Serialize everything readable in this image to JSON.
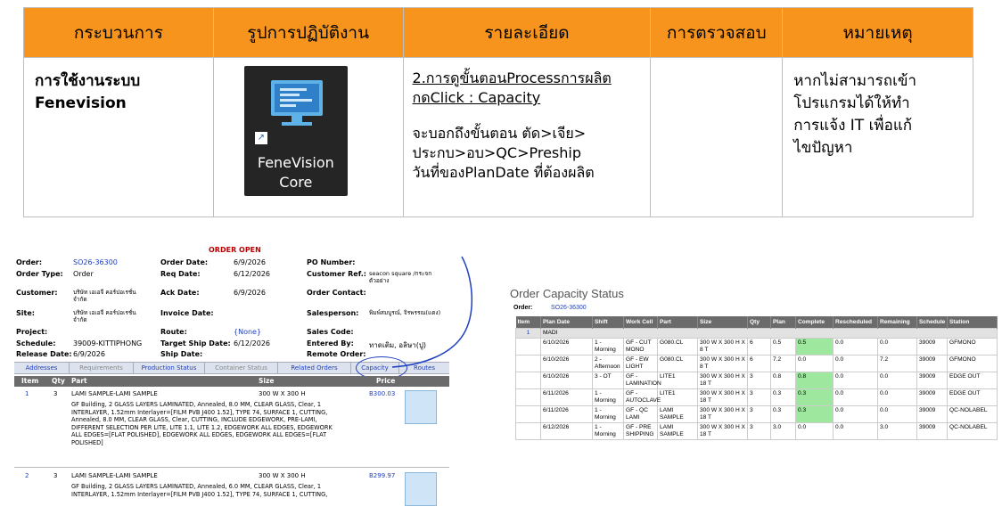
{
  "top_table": {
    "headers": [
      "กระบวนการ",
      "รูปการปฏิบัติงาน",
      "รายละเอียด",
      "การตรวจสอบ",
      "หมายเหตุ"
    ],
    "process_line1": "การใช้งานระบบ",
    "process_line2": "Fenevision",
    "icon": {
      "name": "fenevision-core-icon",
      "label_line1": "FeneVision",
      "label_line2": "Core"
    },
    "detail_line1": "2.การดูขั้นตอนProcessการผลิต",
    "detail_line2": "กดClick : Capacity",
    "detail_line3": "จะบอกถึงขั้นตอน ตัด>เจีย>",
    "detail_line4": "ประกบ>อบ>QC>Preship",
    "detail_line5": "วันที่ของPlanDate ที่ต้องผลิต",
    "check": "",
    "note_line1": "หากไม่สามารถเข้า",
    "note_line2": "โปรแกรมได้ให้ทำ",
    "note_line3": "การแจ้ง IT  เพื่อแก้",
    "note_line4": "ไขปัญหา"
  },
  "order_detail": {
    "title": "ORDER OPEN",
    "order_label": "Order:",
    "order_value": "SO26-36300",
    "order_date_label": "Order Date:",
    "order_date_value": "6/9/2026",
    "po_label": "PO Number:",
    "po_value": "",
    "order_type_label": "Order Type:",
    "order_type_value": "Order",
    "req_date_label": "Req Date:",
    "req_date_value": "6/12/2026",
    "cust_ref_label": "Customer Ref.:",
    "cust_ref_value": "seacon square /กระจกตัวอย่าง",
    "customer_label": "Customer:",
    "customer_value": "บริษัท เอเอจี คอร์ปอเรชั่นจำกัด",
    "ack_date_label": "Ack Date:",
    "ack_date_value": "6/9/2026",
    "order_contact_label": "Order Contact:",
    "order_contact_value": "",
    "site_label": "Site:",
    "site_value": "บริษัท เอเอจี คอร์ปอเรชั่นจำกัด",
    "invoice_date_label": "Invoice Date:",
    "invoice_date_value": "",
    "salesperson_label": "Salesperson:",
    "salesperson_value": "พิมพ์สมบูรณ์, จิรพรรณ(แดง)",
    "project_label": "Project:",
    "project_value": "",
    "route_label": "Route:",
    "route_value": "{None}",
    "sales_code_label": "Sales Code:",
    "sales_code_value": "",
    "schedule_label": "Schedule:",
    "schedule_value": "39009-KITTIPHONG",
    "target_ship_label": "Target Ship Date:",
    "target_ship_value": "6/12/2026",
    "entered_by_label": "Entered By:",
    "entered_by_value": "ทาดเติม, อลิษา(ปู)",
    "release_date_label": "Release Date:",
    "release_date_value": "6/9/2026",
    "ship_date_label": "Ship Date:",
    "ship_date_value": "",
    "remote_order_label": "Remote Order:",
    "remote_order_value": "",
    "tabs": [
      "Addresses",
      "Requirements",
      "Production Status",
      "Container Status",
      "Related Orders",
      "Capacity",
      "Routes"
    ],
    "item_headers": {
      "item": "Item",
      "qty": "Qty",
      "part": "Part",
      "size": "Size",
      "price": "Price"
    },
    "items": [
      {
        "item": "1",
        "qty": "3",
        "part": "LAMI SAMPLE-LAMI SAMPLE",
        "size": "300 W X 300 H",
        "price": "B300.03",
        "desc": "GF Building, 2 GLASS LAYERS LAMINATED, Annealed, 8.0 MM, CLEAR GLASS, Clear, 1 INTERLAYER, 1.52mm Interlayer=[FILM PVB J400 1.52], TYPE 74, SURFACE 1, CUTTING, Annealed, 8.0 MM, CLEAR GLASS, Clear, CUTTING, INCLUDE EDGEWORK, PRE-LAMI, DIFFERENT SELECTION PER LITE, LITE 1.1, LITE 1.2, EDGEWORK ALL EDGES, EDGEWORK ALL EDGES=[FLAT POLISHED], EDGEWORK ALL EDGES, EDGEWORK ALL EDGES=[FLAT POLISHED]"
      },
      {
        "item": "2",
        "qty": "3",
        "part": "LAMI SAMPLE-LAMI SAMPLE",
        "size": "300 W X 300 H",
        "price": "B299.97",
        "desc": "GF Building, 2 GLASS LAYERS LAMINATED, Annealed, 6.0 MM, CLEAR GLASS, Clear, 1 INTERLAYER, 1.52mm Interlayer=[FILM PVB J400 1.52], TYPE 74, SURFACE 1, CUTTING,"
      }
    ]
  },
  "capacity": {
    "title": "Order Capacity Status",
    "order_label": "Order:",
    "order_value": "SO26-36300",
    "headers": [
      "Item",
      "Plan Date",
      "Shift",
      "Work Cell",
      "Part",
      "Size",
      "Qty",
      "Plan",
      "Complete",
      "Rescheduled",
      "Remaining",
      "Schedule",
      "Station"
    ],
    "group_row": {
      "item": "1",
      "label": "MADI"
    },
    "rows": [
      [
        "",
        "6/10/2026",
        "1 - Morning",
        "GF - CUT MONO",
        "G080.CL",
        "300 W X 300 H X 8 T",
        "6",
        "0.5",
        "0.5",
        "0.0",
        "0.0",
        "39009",
        "GFMONO"
      ],
      [
        "",
        "6/10/2026",
        "2 - Afternoon",
        "GF - EW LIGHT",
        "G080.CL",
        "300 W X 300 H X 8 T",
        "6",
        "7.2",
        "0.0",
        "0.0",
        "7.2",
        "39009",
        "GFMONO"
      ],
      [
        "",
        "6/10/2026",
        "3 - OT",
        "GF - LAMINATION",
        "LITE1",
        "300 W X 300 H X 18 T",
        "3",
        "0.8",
        "0.8",
        "0.0",
        "0.0",
        "39009",
        "EDGE OUT"
      ],
      [
        "",
        "6/11/2026",
        "1 - Morning",
        "GF - AUTOCLAVE",
        "LITE1",
        "300 W X 300 H X 18 T",
        "3",
        "0.3",
        "0.3",
        "0.0",
        "0.0",
        "39009",
        "EDGE OUT"
      ],
      [
        "",
        "6/11/2026",
        "1 - Morning",
        "GF - QC LAMI",
        "LAMI SAMPLE",
        "300 W X 300 H X 18 T",
        "3",
        "0.3",
        "0.3",
        "0.0",
        "0.0",
        "39009",
        "QC-NOLABEL"
      ],
      [
        "",
        "6/12/2026",
        "1 - Morning",
        "GF - PRE SHIPPING",
        "LAMI SAMPLE",
        "300 W X 300 H X 18 T",
        "3",
        "3.0",
        "0.0",
        "0.0",
        "3.0",
        "39009",
        "QC-NOLABEL"
      ]
    ],
    "green_complete_rows": [
      0,
      2,
      3,
      4
    ]
  }
}
